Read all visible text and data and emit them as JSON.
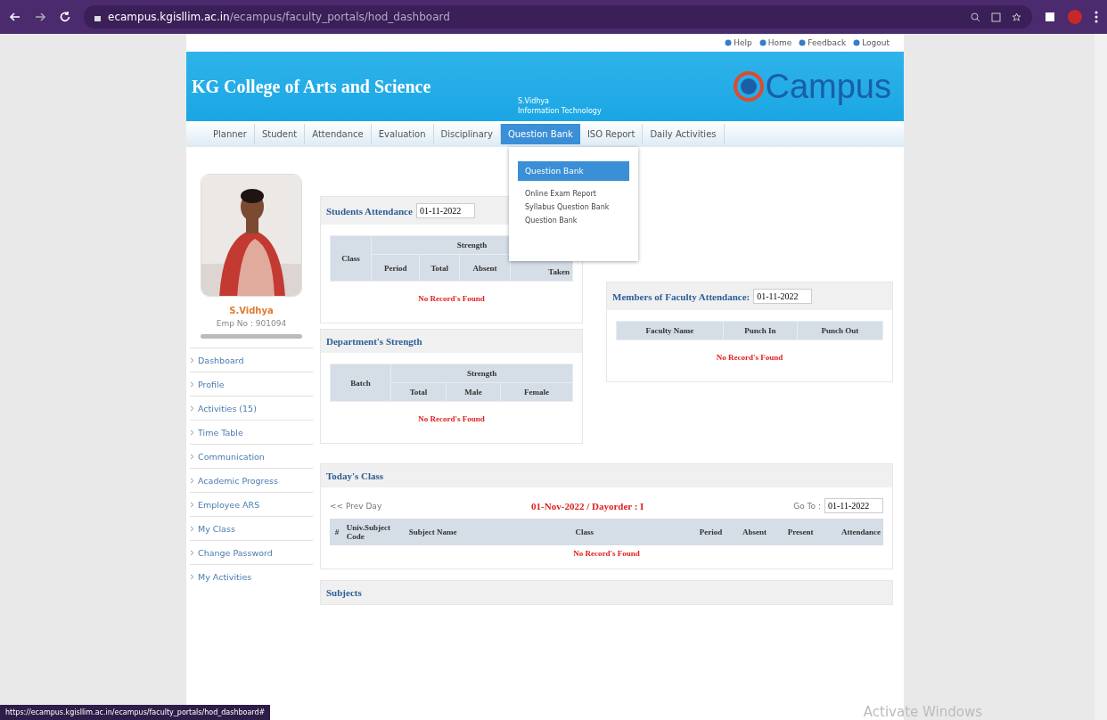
{
  "browser": {
    "url_host": "ecampus.kgisllim.ac.in",
    "url_path": "/ecampus/faculty_portals/hod_dashboard"
  },
  "top_links": [
    "Help",
    "Home",
    "Feedback",
    "Logout"
  ],
  "header": {
    "college": "KG College of Arts and Science",
    "user_name": "S.Vidhya",
    "department": "Information Technology",
    "logo": "Campus"
  },
  "nav": [
    {
      "label": "Planner",
      "selected": false
    },
    {
      "label": "Student",
      "selected": false
    },
    {
      "label": "Attendance",
      "selected": false
    },
    {
      "label": "Evaluation",
      "selected": false
    },
    {
      "label": "Disciplinary",
      "selected": false
    },
    {
      "label": "Question Bank",
      "selected": true
    },
    {
      "label": "ISO Report",
      "selected": false
    },
    {
      "label": "Daily Activities",
      "selected": false
    }
  ],
  "dropdown": {
    "heading": "Question Bank",
    "items": [
      "Online Exam Report",
      "Syllabus Question Bank",
      "Question Bank"
    ]
  },
  "profile": {
    "name": "S.Vidhya",
    "emp_no": "Emp No : 901094"
  },
  "sidebar": [
    "Dashboard",
    "Profile",
    "Activities (15)",
    "Time Table",
    "Communication",
    "Academic Progress",
    "Employee ARS",
    "My Class",
    "Change Password",
    "My Activities"
  ],
  "students_attendance": {
    "title": "Students Attendance",
    "date": "01-11-2022",
    "group": "Strength",
    "row_header": "Class",
    "columns": [
      "Period",
      "Total",
      "Absent",
      "Taken"
    ],
    "empty": "No Record's Found"
  },
  "department_strength": {
    "title": "Department's Strength",
    "group": "Strength",
    "row_header": "Batch",
    "columns": [
      "Total",
      "Male",
      "Female"
    ],
    "empty": "No Record's Found"
  },
  "faculty_attendance": {
    "title": "Members of Faculty Attendance:",
    "date": "01-11-2022",
    "columns": [
      "Faculty Name",
      "Punch In",
      "Punch Out"
    ],
    "empty": "No Record's Found"
  },
  "todays_class": {
    "title": "Today's Class",
    "prev": "<< Prev Day",
    "day": "01-Nov-2022 / Dayorder : I",
    "goto_label": "Go To :",
    "goto_date": "01-11-2022",
    "columns": [
      "#",
      "Univ.Subject Code",
      "Subject Name",
      "Class",
      "Period",
      "Absent",
      "Present",
      "Attendance"
    ],
    "empty": "No Record's Found"
  },
  "subjects": {
    "title": "Subjects"
  },
  "status_url": "https://ecampus.kgisllim.ac.in/ecampus/faculty_portals/hod_dashboard#",
  "os_notice": "Activate Windows"
}
